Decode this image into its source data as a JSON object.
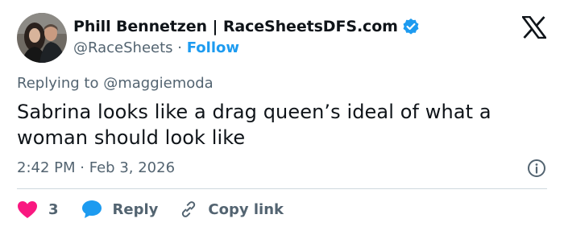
{
  "author": {
    "name": "Phill Bennetzen | RaceSheetsDFS.com",
    "handle": "@RaceSheets",
    "separator": "·",
    "follow_label": "Follow",
    "verified_color": "#1d9bf0"
  },
  "reply_context": {
    "prefix": "Replying to",
    "mention": "@maggiemoda"
  },
  "tweet": {
    "text": "Sabrina looks like a drag queen’s ideal of what a woman should look like",
    "time": "2:42 PM",
    "separator": "·",
    "date": "Feb 3, 2026"
  },
  "actions": {
    "like_count": "3",
    "like_icon": "heart-icon",
    "like_color": "#f91880",
    "reply_label": "Reply",
    "reply_icon": "speech-bubble-icon",
    "reply_color": "#1d9bf0",
    "copy_label": "Copy link",
    "copy_icon": "link-icon"
  },
  "icons": {
    "platform": "x-logo-icon",
    "info": "info-icon"
  }
}
